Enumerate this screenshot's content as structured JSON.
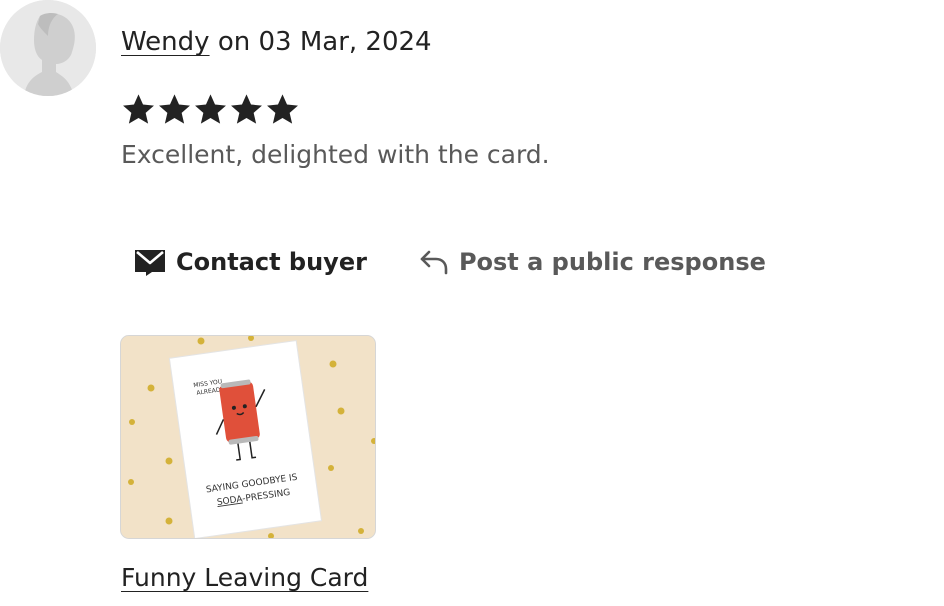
{
  "review": {
    "reviewer_name": "Wendy",
    "date_prefix": " on ",
    "date": "03 Mar, 2024",
    "rating": 5,
    "max_rating": 5,
    "text": "Excellent, delighted with the card."
  },
  "actions": {
    "contact_label": "Contact buyer",
    "respond_label": "Post a public response"
  },
  "listing": {
    "title": "Funny Leaving Card",
    "card_text_small": [
      "MISS YOU",
      "ALREADY"
    ],
    "card_text_main_line1": "SAYING GOODBYE IS",
    "card_text_main_line2_underlined": "SODA",
    "card_text_main_line2_rest": "-PRESSING"
  },
  "colors": {
    "text": "#222222",
    "muted": "#595959",
    "card_bg": "#f2e2c8",
    "dot_gold": "#d4b23a",
    "can_red": "#e0503a"
  },
  "icons": {
    "avatar": "default-user-silhouette",
    "star": "star-icon",
    "contact": "envelope-icon",
    "respond": "reply-arrow-icon"
  }
}
